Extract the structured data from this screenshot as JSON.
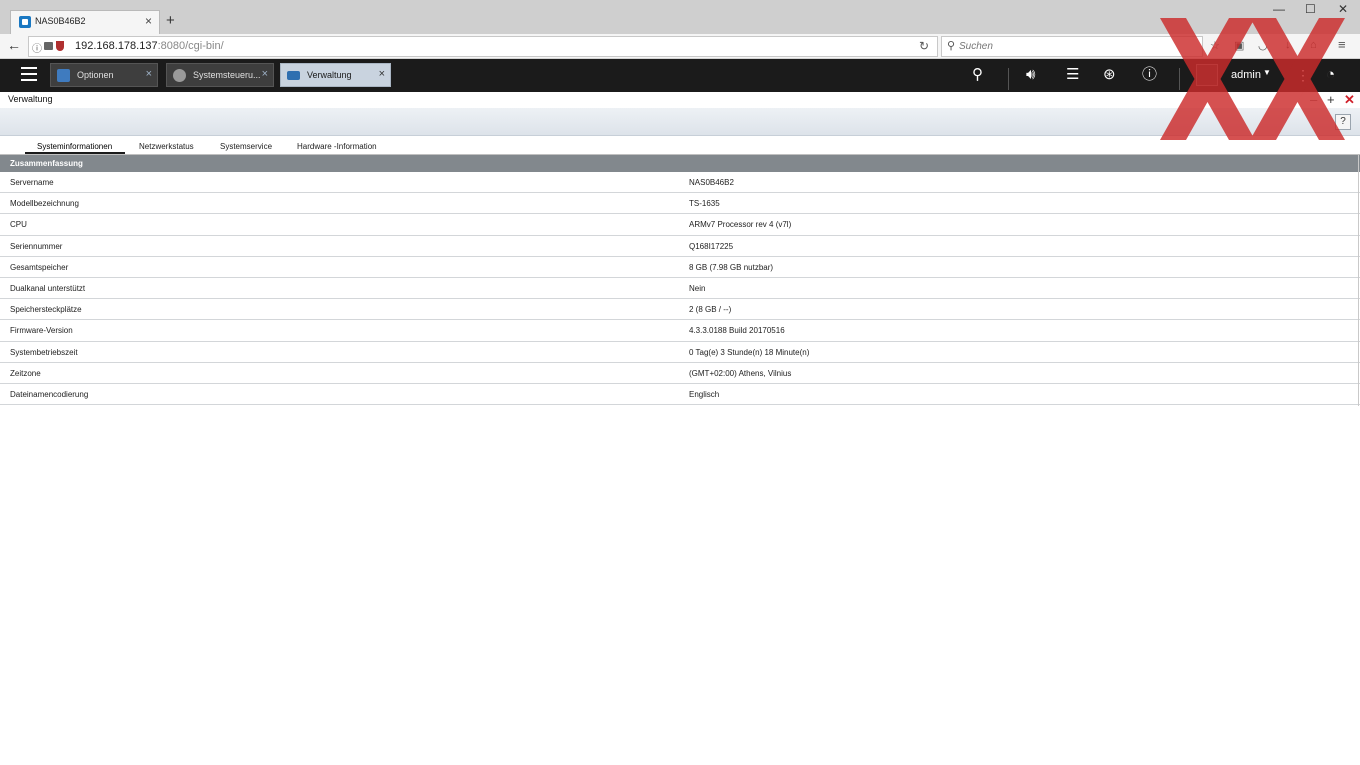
{
  "browser": {
    "tab_title": "NAS0B46B2",
    "url_host": "192.168.178.137",
    "url_rest": ":8080/cgi-bin/",
    "search_placeholder": "Suchen"
  },
  "app_tabs": [
    {
      "label": "Optionen",
      "icon": "options-icon",
      "color": "#3f7bbf"
    },
    {
      "label": "Systemsteueru...",
      "icon": "gear-icon",
      "color": "#9a9a9a"
    },
    {
      "label": "Verwaltung",
      "icon": "monitor-icon",
      "color": "#2f6fb0"
    }
  ],
  "user": {
    "name": "admin"
  },
  "window": {
    "title": "Verwaltung"
  },
  "help_label": "?",
  "subtabs": [
    "Systeminformationen",
    "Netzwerkstatus",
    "Systemservice",
    "Hardware -Information"
  ],
  "summary": {
    "header": "Zusammenfassung",
    "rows": [
      {
        "key": "Servername",
        "value": "NAS0B46B2"
      },
      {
        "key": "Modellbezeichnung",
        "value": "TS-1635"
      },
      {
        "key": "CPU",
        "value": "ARMv7 Processor rev 4 (v7l)"
      },
      {
        "key": "Seriennummer",
        "value": "Q168I17225"
      },
      {
        "key": "Gesamtspeicher",
        "value": "8 GB (7.98 GB nutzbar)"
      },
      {
        "key": "Dualkanal unterstützt",
        "value": "Nein"
      },
      {
        "key": "Speichersteckplätze",
        "value": "2 (8 GB / --)"
      },
      {
        "key": "Firmware-Version",
        "value": "4.3.3.0188 Build 20170516"
      },
      {
        "key": "Systembetriebszeit",
        "value": "0 Tag(e) 3 Stunde(n) 18 Minute(n)"
      },
      {
        "key": "Zeitzone",
        "value": "(GMT+02:00) Athens, Vilnius"
      },
      {
        "key": "Dateinamencodierung",
        "value": "Englisch"
      }
    ]
  },
  "colors": {
    "qnap_bar": "#1b1b1b",
    "header_band": "#82888d",
    "close_red": "#d0202a",
    "watermark_red": "#cc2b2b"
  }
}
